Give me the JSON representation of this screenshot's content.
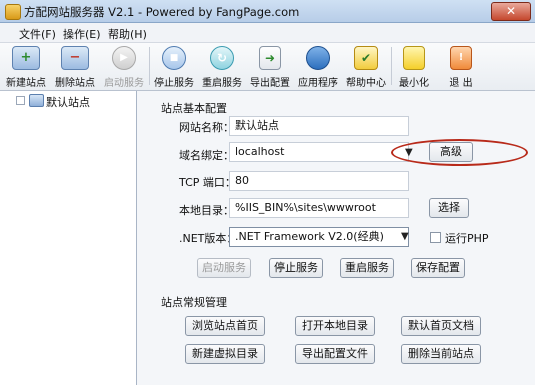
{
  "window": {
    "title": "方配网站服务器 V2.1 - Powered by FangPage.com",
    "close_glyph": "✕"
  },
  "menu": [
    "文件(F)",
    "操作(E)",
    "帮助(H)"
  ],
  "toolbar": [
    {
      "label": "新建站点",
      "icon": "new-site-icon",
      "enabled": true
    },
    {
      "label": "删除站点",
      "icon": "delete-site-icon",
      "enabled": true
    },
    {
      "label": "启动服务",
      "icon": "start-icon",
      "enabled": false
    },
    {
      "label": "停止服务",
      "icon": "stop-icon",
      "enabled": true
    },
    {
      "label": "重启服务",
      "icon": "restart-icon",
      "enabled": true
    },
    {
      "label": "导出配置",
      "icon": "export-icon",
      "enabled": true
    },
    {
      "label": "应用程序",
      "icon": "application-icon",
      "enabled": true
    },
    {
      "label": "帮助中心",
      "icon": "help-icon",
      "enabled": true
    },
    {
      "label": "最小化",
      "icon": "minimize-icon",
      "enabled": true
    },
    {
      "label": "退 出",
      "icon": "exit-icon",
      "enabled": true
    }
  ],
  "tree": {
    "root_label": "默认站点"
  },
  "basic": {
    "title": "站点基本配置",
    "site_name_label": "网站名称：",
    "site_name": "默认站点",
    "domain_label": "域名绑定：",
    "domain": "localhost",
    "advanced_button": "高级",
    "port_label": "TCP 端口：",
    "port": "80",
    "dir_label": "本地目录：",
    "dir": "%IIS_BIN%\\sites\\wwwroot",
    "browse_button": "选择",
    "net_label": ".NET版本：",
    "net_version": ".NET Framework V2.0(经典)",
    "php_label": "运行PHP",
    "php_checked": false,
    "start_button": "启动服务",
    "stop_button": "停止服务",
    "restart_button": "重启服务",
    "save_button": "保存配置"
  },
  "manage": {
    "title": "站点常规管理",
    "buttons": [
      "浏览站点首页",
      "打开本地目录",
      "默认首页文档",
      "新建虚拟目录",
      "导出配置文件",
      "删除当前站点"
    ]
  }
}
